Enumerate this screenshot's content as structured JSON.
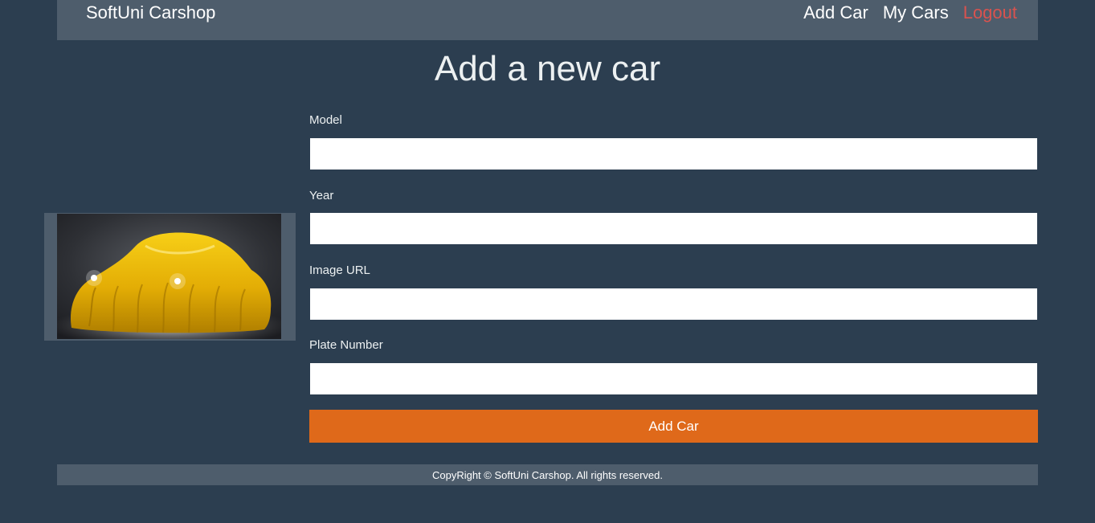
{
  "header": {
    "brand": "SoftUni Carshop",
    "nav": {
      "add_car": "Add Car",
      "my_cars": "My Cars",
      "logout": "Logout"
    }
  },
  "main": {
    "title": "Add a new car",
    "image": {
      "icon": "covered-car-image",
      "cover_color": "#e6b200"
    },
    "form": {
      "fields": [
        {
          "label": "Model",
          "value": "",
          "placeholder": ""
        },
        {
          "label": "Year",
          "value": "",
          "placeholder": ""
        },
        {
          "label": "Image URL",
          "value": "",
          "placeholder": ""
        },
        {
          "label": "Plate Number",
          "value": "",
          "placeholder": ""
        }
      ],
      "submit_label": "Add Car"
    }
  },
  "footer": {
    "text": "CopyRight © SoftUni Carshop. All rights reserved."
  },
  "colors": {
    "background": "#2c3e50",
    "panel": "#4e5d6c",
    "accent": "#df691a",
    "logout": "#d9534f"
  }
}
